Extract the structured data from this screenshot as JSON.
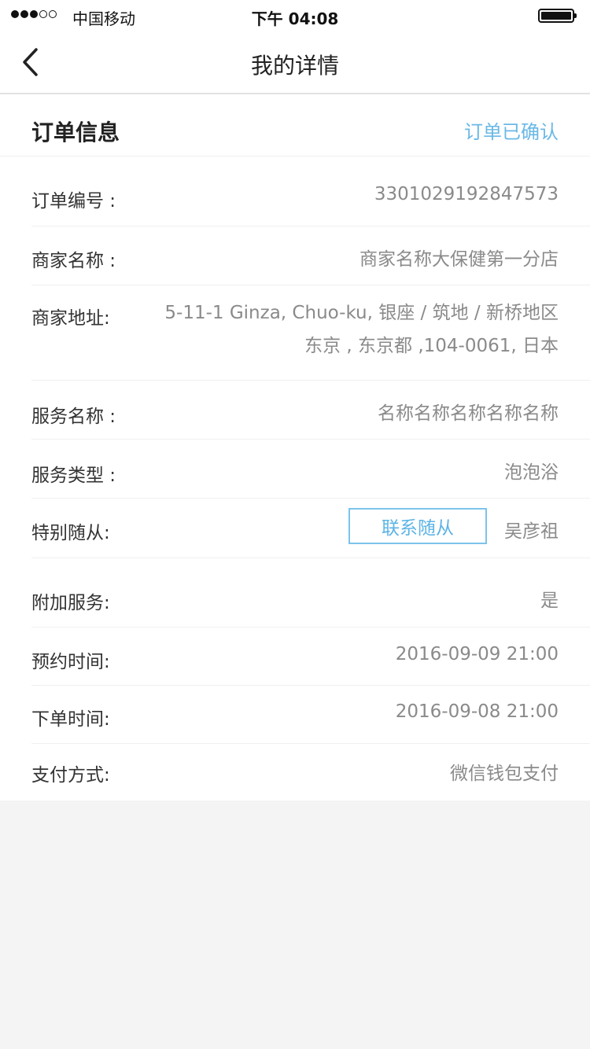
{
  "status_bar": {
    "carrier": "中国移动",
    "time": "下午 04:08"
  },
  "nav": {
    "title": "我的详情",
    "back_icon": "chevron-left-icon"
  },
  "order_section": {
    "title": "订单信息",
    "status": "订单已确认"
  },
  "rows": {
    "order_no": {
      "label": "订单编号 :",
      "value": "3301029192847573"
    },
    "merchant_name": {
      "label": "商家名称 :",
      "value": "商家名称大保健第一分店"
    },
    "merchant_address": {
      "label": "商家地址:",
      "line1": "5-11-1 Ginza, Chuo-ku, 银座 / 筑地 / 新桥地区",
      "line2": "东京 , 东京都 ,104-0061, 日本"
    },
    "service_name": {
      "label": "服务名称 :",
      "value": "名称名称名称名称名称"
    },
    "service_type": {
      "label": "服务类型 :",
      "value": "泡泡浴"
    },
    "companion": {
      "label": "特别随从:",
      "button": "联系随从",
      "value": "吴彦祖"
    },
    "extra_service": {
      "label": "附加服务:",
      "value": "是"
    },
    "booking_time": {
      "label": "预约时间:",
      "value": "2016-09-09 21:00"
    },
    "order_time": {
      "label": "下单时间:",
      "value": "2016-09-08 21:00"
    },
    "payment": {
      "label": "支付方式:",
      "value": "微信钱包支付"
    }
  },
  "colors": {
    "accent": "#6ab8e6",
    "background": "#f4f4f4"
  }
}
